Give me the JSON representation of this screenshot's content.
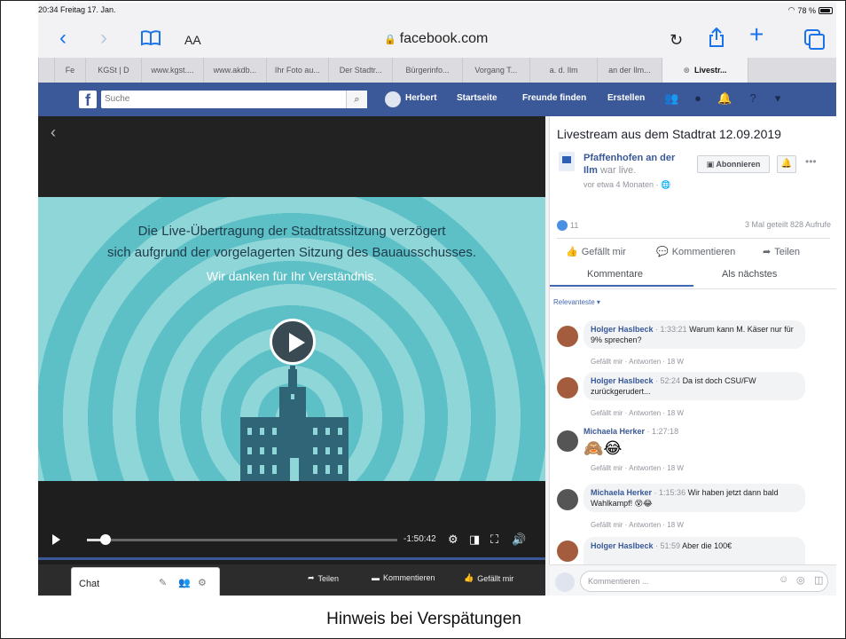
{
  "status_bar": {
    "time_date": "20:34  Freitag 17. Jan.",
    "battery": "78 %"
  },
  "browser": {
    "text_size_label": "AA",
    "url": "facebook.com",
    "tabs": [
      "Fe",
      "KGSt | D",
      "www.kgst....",
      "www.akdb...",
      "Ihr Foto au...",
      "Der Stadtr...",
      "Bürgerinfo...",
      "Vorgang T...",
      "a. d. Ilm",
      "an der Ilm...",
      "Livestr..."
    ]
  },
  "fb_header": {
    "search_placeholder": "Suche",
    "user": "Herbert",
    "nav": [
      "Startseite",
      "Freunde finden",
      "Erstellen"
    ]
  },
  "video": {
    "line1": "Die Live-Übertragung der Stadtratssitzung verzögert",
    "line2": "sich aufgrund der vorgelagerten Sitzung des Bauausschusses.",
    "line3": "Wir danken für Ihr Verständnis.",
    "time_remaining": "-1:50:42",
    "progress": 0.06,
    "actions": {
      "share": "Teilen",
      "comment": "Kommentieren",
      "like": "Gefällt mir"
    }
  },
  "chat": {
    "label": "Chat"
  },
  "post": {
    "title": "Livestream aus dem Stadtrat 12.09.2019",
    "page_name": "Pfaffenhofen an der Ilm",
    "was_live": "war live.",
    "time": "vor etwa 4 Monaten · ",
    "subscribe": "Abonnieren",
    "likes": "11",
    "stats": "3 Mal geteilt  828 Aufrufe",
    "actions": {
      "like": "Gefällt mir",
      "comment": "Kommentieren",
      "share": "Teilen"
    },
    "tabs": {
      "comments": "Kommentare",
      "next": "Als nächstes"
    },
    "sort": "Relevanteste ▾"
  },
  "comments": [
    {
      "name": "Holger Haslbeck",
      "ts": " · 1:33:21 ",
      "text": "Warum kann M. Käser nur für 9% sprechen?",
      "meta": "Gefällt mir · Antworten · 18 W"
    },
    {
      "name": "Holger Haslbeck",
      "ts": " · 52:24 ",
      "text": "Da ist doch CSU/FW zurückgerudert...",
      "meta": "Gefällt mir · Antworten · 18 W"
    },
    {
      "name": "Michaela Herker",
      "ts": " · 1:27:18",
      "text": "",
      "meta": "Gefällt mir · Antworten · 18 W"
    },
    {
      "name": "Michaela Herker",
      "ts": " · 1:15:36 ",
      "text": "Wir haben jetzt dann bald Wahlkampf! 😵😂",
      "meta": "Gefällt mir · Antworten · 18 W"
    },
    {
      "name": "Holger Haslbeck",
      "ts": " · 51:59 ",
      "text": "Aber die 100€",
      "meta": ""
    }
  ],
  "comment_box": {
    "placeholder": "Kommentieren ..."
  },
  "caption": "Hinweis bei Verspätungen"
}
